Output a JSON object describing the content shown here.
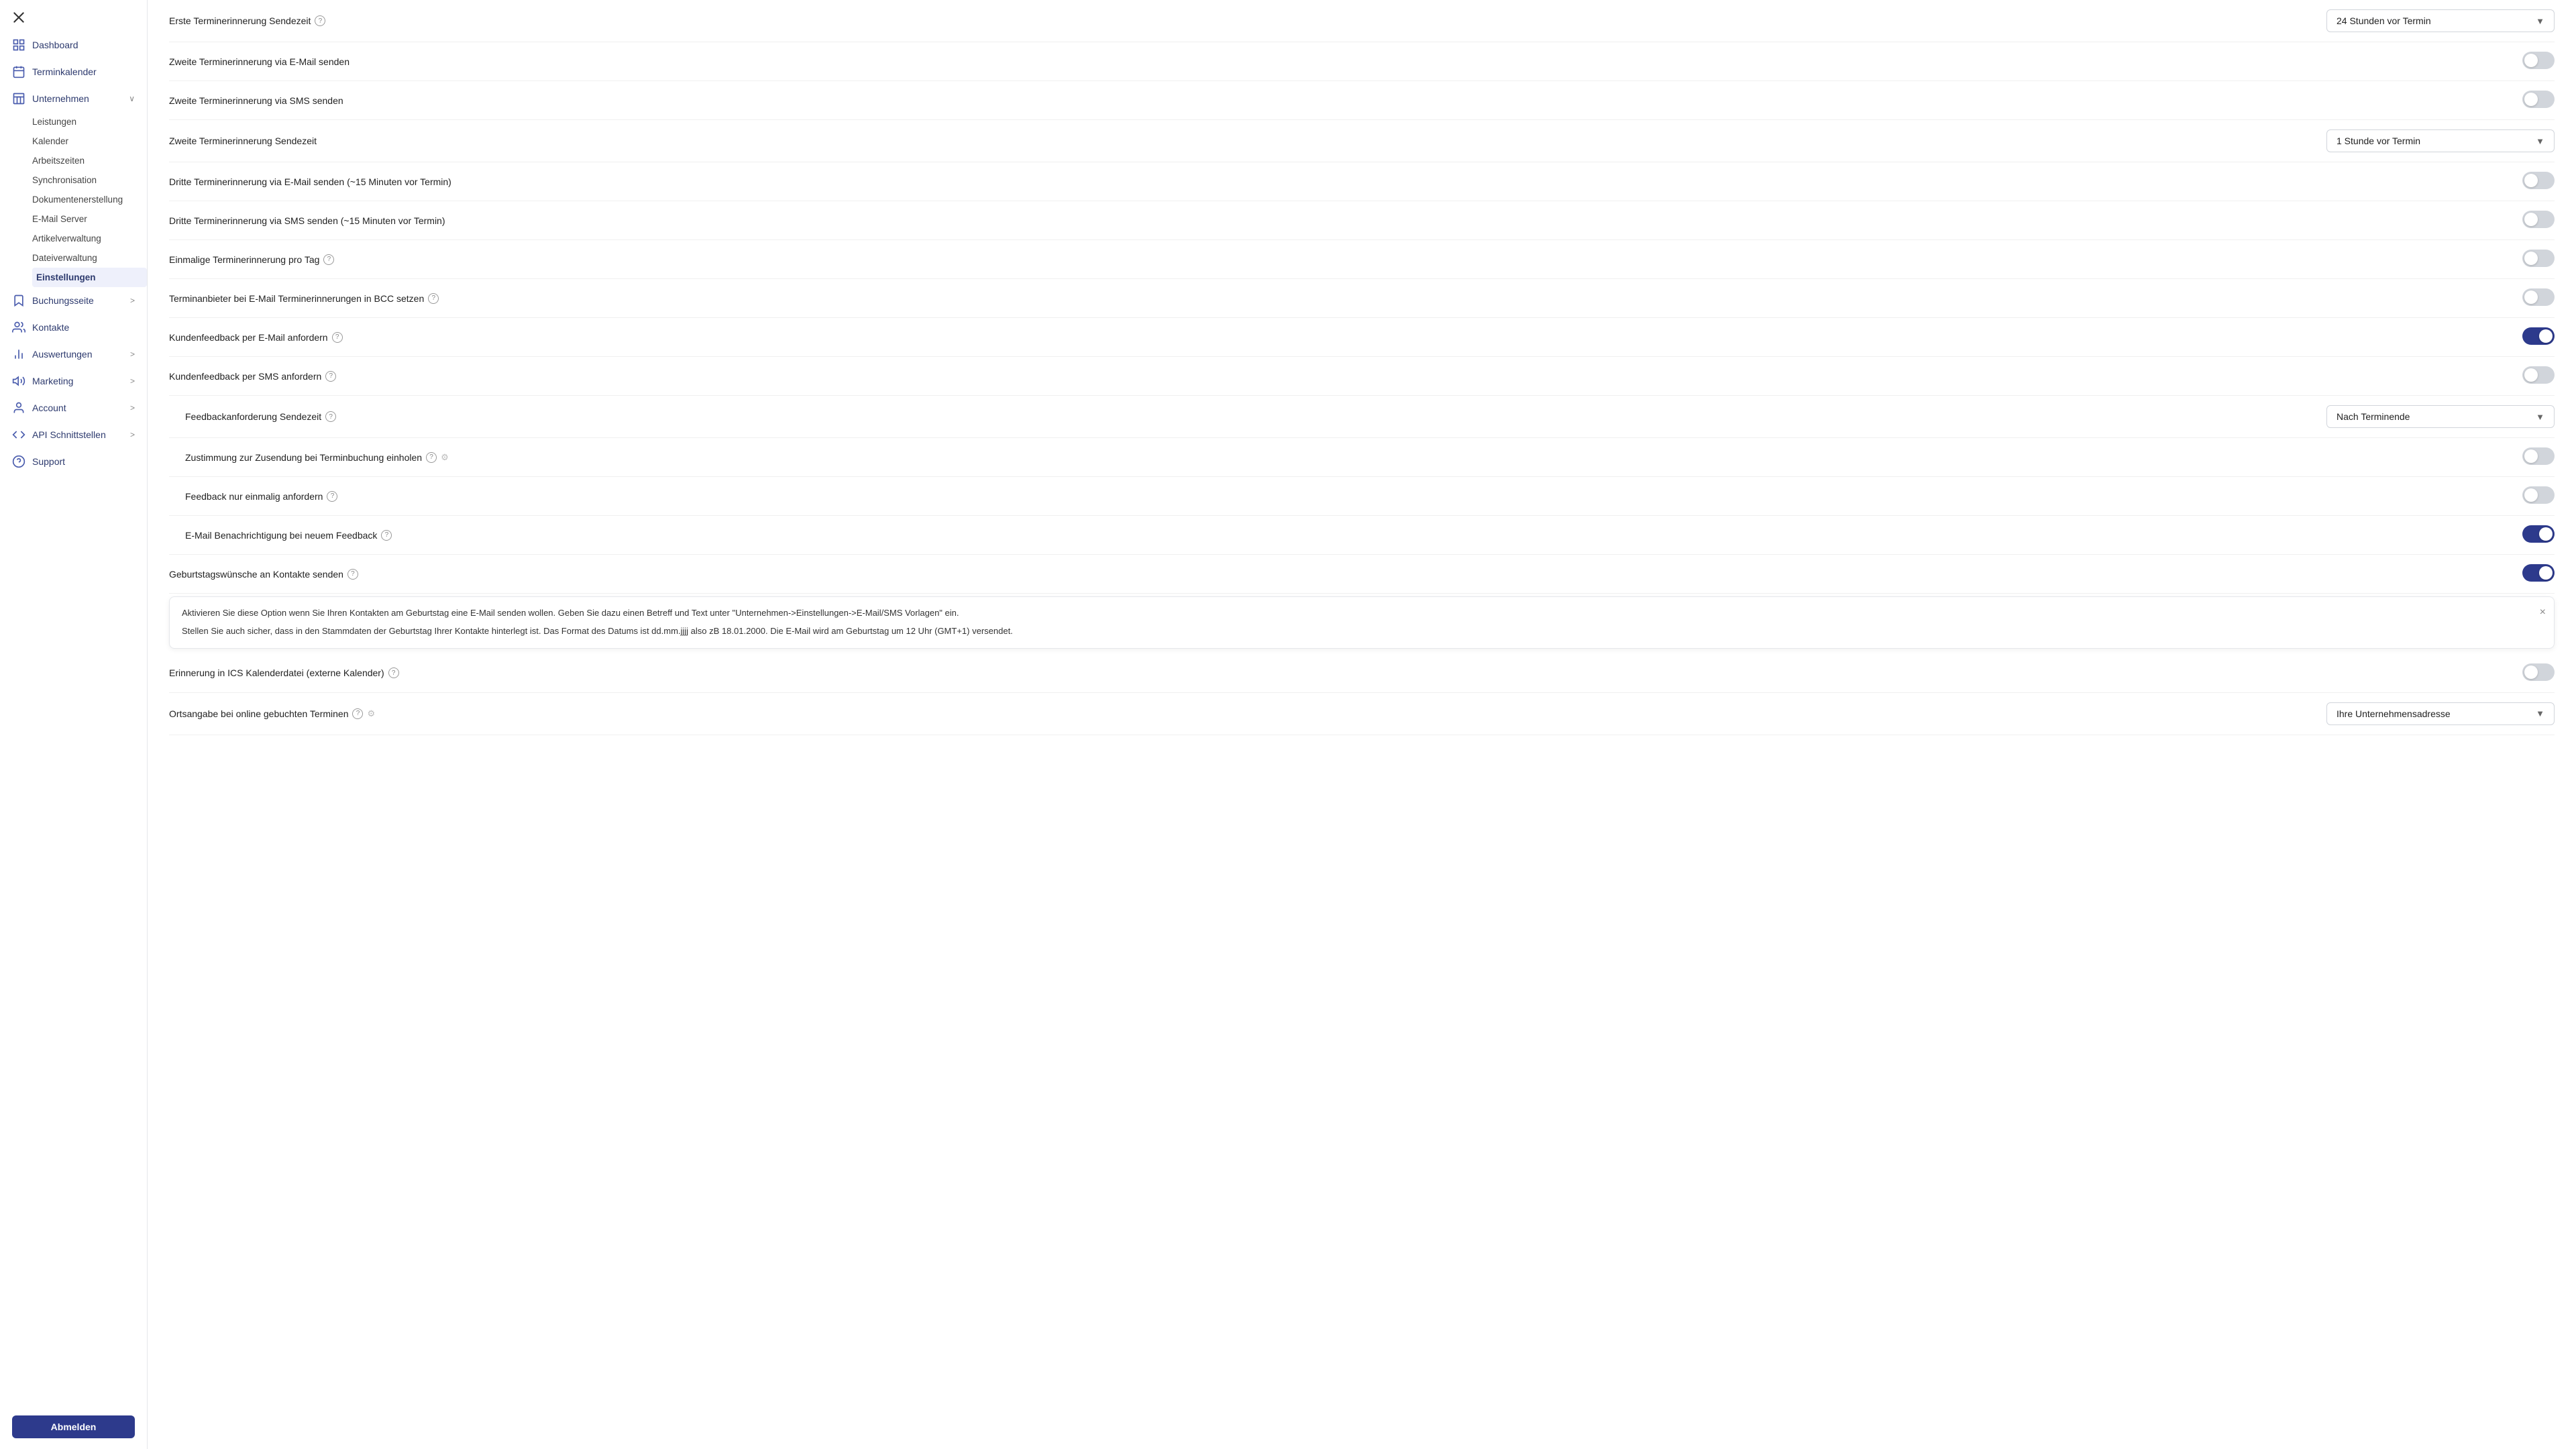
{
  "sidebar": {
    "close_icon": "×",
    "nav_items": [
      {
        "id": "dashboard",
        "label": "Dashboard",
        "icon": "grid"
      },
      {
        "id": "terminkalender",
        "label": "Terminkalender",
        "icon": "calendar"
      },
      {
        "id": "unternehmen",
        "label": "Unternehmen",
        "icon": "building",
        "chevron": "∨",
        "expanded": true
      }
    ],
    "sub_items": [
      {
        "id": "leistungen",
        "label": "Leistungen",
        "active": false
      },
      {
        "id": "kalender",
        "label": "Kalender",
        "active": false
      },
      {
        "id": "arbeitszeiten",
        "label": "Arbeitszeiten",
        "active": false
      },
      {
        "id": "synchronisation",
        "label": "Synchronisation",
        "active": false
      },
      {
        "id": "dokumentenerstellung",
        "label": "Dokumentenerstellung",
        "active": false
      },
      {
        "id": "emailserver",
        "label": "E-Mail Server",
        "active": false
      },
      {
        "id": "artikelverwaltung",
        "label": "Artikelverwaltung",
        "active": false
      },
      {
        "id": "dateiverwaltung",
        "label": "Dateiverwaltung",
        "active": false
      },
      {
        "id": "einstellungen",
        "label": "Einstellungen",
        "active": true
      }
    ],
    "nav_bottom": [
      {
        "id": "buchungsseite",
        "label": "Buchungsseite",
        "icon": "bookmark",
        "chevron": ">"
      },
      {
        "id": "kontakte",
        "label": "Kontakte",
        "icon": "users"
      },
      {
        "id": "auswertungen",
        "label": "Auswertungen",
        "icon": "chart",
        "chevron": ">"
      },
      {
        "id": "marketing",
        "label": "Marketing",
        "icon": "megaphone",
        "chevron": ">"
      },
      {
        "id": "account",
        "label": "Account",
        "icon": "person",
        "chevron": ">"
      },
      {
        "id": "apischnittstellen",
        "label": "API Schnittstellen",
        "icon": "api",
        "chevron": ">"
      },
      {
        "id": "support",
        "label": "Support",
        "icon": "help"
      }
    ],
    "abmelden_label": "Abmelden"
  },
  "settings": {
    "rows": [
      {
        "id": "erste-termin-sendezeit",
        "label": "Erste Terminerinnerung Sendezeit",
        "has_help": true,
        "control": "dropdown",
        "value": "24 Stunden vor Termin",
        "indented": false
      },
      {
        "id": "zweite-email",
        "label": "Zweite Terminerinnerung via E-Mail senden",
        "has_help": false,
        "control": "toggle",
        "on": false,
        "indented": false
      },
      {
        "id": "zweite-sms",
        "label": "Zweite Terminerinnerung via SMS senden",
        "has_help": false,
        "control": "toggle",
        "on": false,
        "indented": false
      },
      {
        "id": "zweite-sendezeit",
        "label": "Zweite Terminerinnerung Sendezeit",
        "has_help": false,
        "control": "dropdown",
        "value": "1 Stunde vor Termin",
        "indented": false
      },
      {
        "id": "dritte-email",
        "label": "Dritte Terminerinnerung via E-Mail senden (~15 Minuten vor Termin)",
        "has_help": false,
        "control": "toggle",
        "on": false,
        "indented": false
      },
      {
        "id": "dritte-sms",
        "label": "Dritte Terminerinnerung via SMS senden (~15 Minuten vor Termin)",
        "has_help": false,
        "control": "toggle",
        "on": false,
        "indented": false
      },
      {
        "id": "einmalige-erinnerung",
        "label": "Einmalige Terminerinnerung pro Tag",
        "has_help": true,
        "control": "toggle",
        "on": false,
        "indented": false
      },
      {
        "id": "terminanbieter-bcc",
        "label": "Terminanbieter bei E-Mail Terminerinnerungen in BCC setzen",
        "has_help": true,
        "control": "toggle",
        "on": false,
        "indented": false
      },
      {
        "id": "kundenfeedback-email",
        "label": "Kundenfeedback per E-Mail anfordern",
        "has_help": true,
        "control": "toggle",
        "on": true,
        "indented": false
      },
      {
        "id": "kundenfeedback-sms",
        "label": "Kundenfeedback per SMS anfordern",
        "has_help": true,
        "control": "toggle",
        "on": false,
        "indented": false
      },
      {
        "id": "feedbackanforderung-sendezeit",
        "label": "Feedbackanforderung Sendezeit",
        "has_help": true,
        "control": "dropdown",
        "value": "Nach Terminende",
        "indented": true
      },
      {
        "id": "zustimmung-terminbuchung",
        "label": "Zustimmung zur Zusendung bei Terminbuchung einholen",
        "has_help": true,
        "has_filter": true,
        "control": "toggle",
        "on": false,
        "indented": true
      },
      {
        "id": "feedback-einmalig",
        "label": "Feedback nur einmalig anfordern",
        "has_help": true,
        "control": "toggle",
        "on": false,
        "indented": true
      },
      {
        "id": "email-benachrichtigung-feedback",
        "label": "E-Mail Benachrichtigung bei neuem Feedback",
        "has_help": true,
        "control": "toggle",
        "on": true,
        "indented": true
      },
      {
        "id": "geburtstagswuensche",
        "label": "Geburtstagswünsche an Kontakte senden",
        "has_help": true,
        "control": "toggle",
        "on": true,
        "indented": false
      }
    ],
    "tooltip": {
      "visible": true,
      "text1": "Aktivieren Sie diese Option wenn Sie Ihren Kontakten am Geburtstag eine E-Mail senden wollen. Geben Sie dazu einen Betreff und Text unter \"Unternehmen->Einstellungen->E-Mail/SMS Vorlagen\" ein.",
      "text2": "Stellen Sie auch sicher, dass in den Stammdaten der Geburtstag Ihrer Kontakte hinterlegt ist. Das Format des Datums ist dd.mm.jjjj also zB 18.01.2000. Die E-Mail wird am Geburtstag um 12 Uhr (GMT+1) versendet."
    },
    "rows_after": [
      {
        "id": "erinnerung-ics",
        "label": "Erinnerung in ICS Kalenderdatei (externe Kalender)",
        "has_help": true,
        "control": "toggle",
        "on": false,
        "indented": false
      },
      {
        "id": "ortsangabe",
        "label": "Ortsangabe bei online gebuchten Terminen",
        "has_help": true,
        "has_filter": true,
        "control": "dropdown",
        "value": "Ihre Unternehmensadresse",
        "indented": false
      }
    ]
  }
}
